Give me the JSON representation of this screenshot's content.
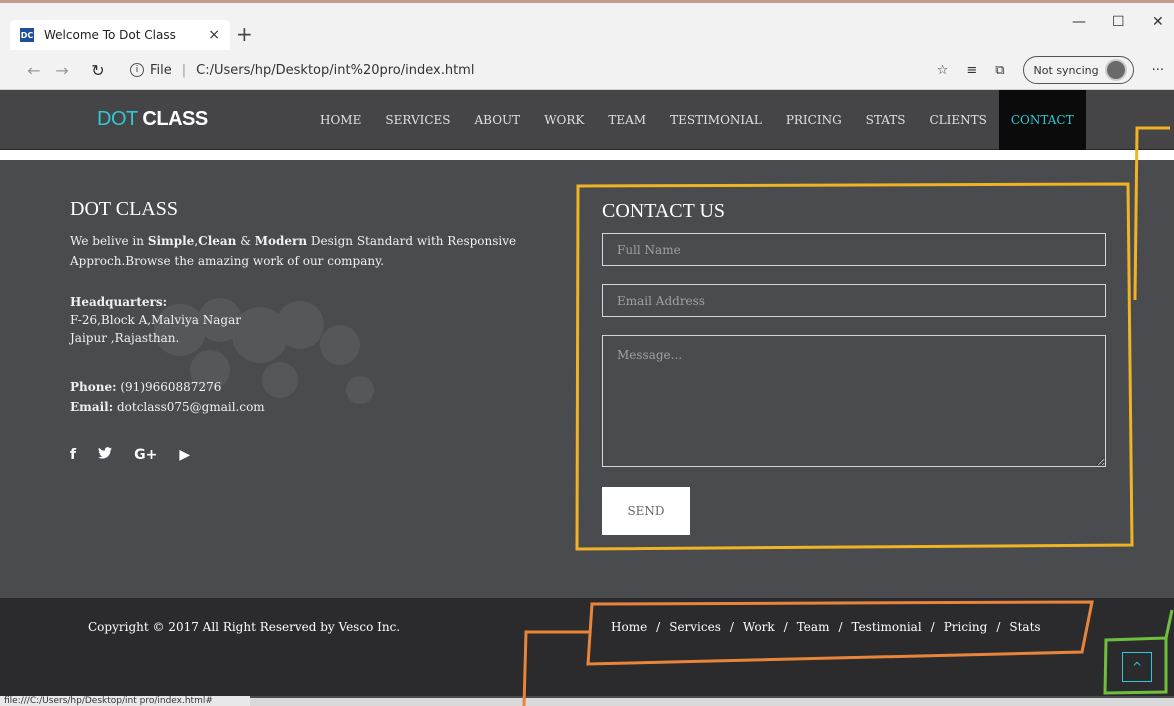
{
  "browser": {
    "tab_title": "Welcome To Dot Class",
    "favicon_text": "DC",
    "tab_close": "×",
    "new_tab": "+",
    "info_label": "File",
    "url": "C:/Users/hp/Desktop/int%20pro/index.html",
    "sync_label": "Not syncing",
    "more": "···",
    "status_url": "file:///C:/Users/hp/Desktop/int pro/index.html#"
  },
  "site": {
    "brand_part1": "DOT",
    "brand_part2": "CLASS",
    "nav": [
      "HOME",
      "SERVICES",
      "ABOUT",
      "WORK",
      "TEAM",
      "TESTIMONIAL",
      "PRICING",
      "STATS",
      "CLIENTS",
      "CONTACT"
    ],
    "active_nav": "CONTACT"
  },
  "about": {
    "title": "DOT CLASS",
    "text_1": "We belive in ",
    "bold_1": "Simple",
    "sep_1": ",",
    "bold_2": "Clean",
    "sep_2": " & ",
    "bold_3": "Modern",
    "text_2": " Design Standard with Responsive Approch.Browse the amazing work of our company.",
    "hq_label": "Headquarters:",
    "hq_line1": "F-26,Block A,Malviya Nagar",
    "hq_line2": "Jaipur ,Rajasthan.",
    "phone_label": "Phone:",
    "phone": " (91)9660887276",
    "email_label": "Email:",
    "email": " dotclass075@gmail.com"
  },
  "social": {
    "facebook": "f",
    "twitter": "🐦",
    "google": "G+",
    "youtube": "▶"
  },
  "contact": {
    "title": "CONTACT US",
    "name_placeholder": "Full Name",
    "email_placeholder": "Email Address",
    "message_placeholder": "Message...",
    "send_label": "SEND"
  },
  "footer": {
    "copyright": "Copyright © 2017 All Right Reserved by Vesco Inc.",
    "links": [
      "Home",
      "Services",
      "Work",
      "Team",
      "Testimonial",
      "Pricing",
      "Stats"
    ],
    "link_separator": "/",
    "to_top": "^"
  },
  "colors": {
    "accent": "#2fc8d6",
    "annotation_yellow": "#f0b323",
    "annotation_orange": "#e8853a",
    "annotation_green": "#6fbf3f"
  }
}
